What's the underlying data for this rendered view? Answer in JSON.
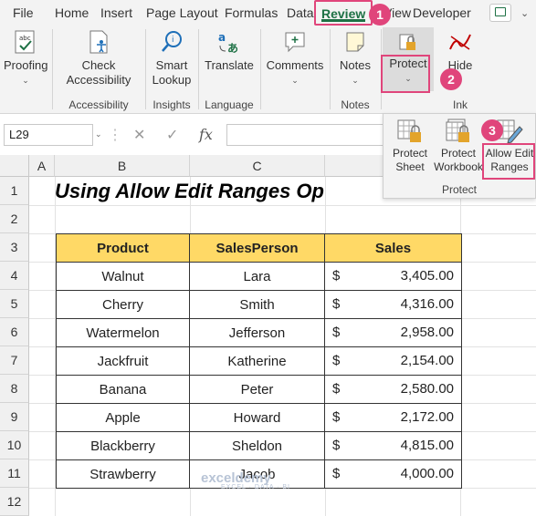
{
  "tabs": [
    "File",
    "Home",
    "Insert",
    "Page Layout",
    "Formulas",
    "Data",
    "Review",
    "View",
    "Developer"
  ],
  "active_tab": "Review",
  "ribbon": {
    "proofing": {
      "label": "Proofing"
    },
    "accessibility": {
      "button": "Check Accessibility",
      "group": "Accessibility"
    },
    "insights": {
      "button": "Smart Lookup",
      "group": "Insights"
    },
    "language": {
      "button": "Translate",
      "group": "Language"
    },
    "comments": {
      "button": "Comments"
    },
    "notes": {
      "button": "Notes",
      "group": "Notes"
    },
    "protect": {
      "button": "Protect"
    },
    "ink": {
      "button": "Hide",
      "group": "Ink"
    }
  },
  "protect_panel": {
    "protect_sheet": "Protect Sheet",
    "protect_workbook": "Protect Workbook",
    "allow_edit_ranges": "Allow Edit Ranges",
    "group": "Protect"
  },
  "badges": [
    "1",
    "2",
    "3"
  ],
  "formula_bar": {
    "name_box": "L29",
    "fx": "fx",
    "cancel": "✕",
    "enter": "✓"
  },
  "columns": [
    "A",
    "B",
    "C"
  ],
  "rows": [
    "1",
    "2",
    "3",
    "4",
    "5",
    "6",
    "7",
    "8",
    "9",
    "10",
    "11",
    "12"
  ],
  "sheet_title": "Using Allow Edit Ranges Op",
  "table": {
    "headers": [
      "Product",
      "SalesPerson",
      "Sales"
    ],
    "rows": [
      {
        "product": "Walnut",
        "person": "Lara",
        "cur": "$",
        "amount": "3,405.00"
      },
      {
        "product": "Cherry",
        "person": "Smith",
        "cur": "$",
        "amount": "4,316.00"
      },
      {
        "product": "Watermelon",
        "person": "Jefferson",
        "cur": "$",
        "amount": "2,958.00"
      },
      {
        "product": "Jackfruit",
        "person": "Katherine",
        "cur": "$",
        "amount": "2,154.00"
      },
      {
        "product": "Banana",
        "person": "Peter",
        "cur": "$",
        "amount": "2,580.00"
      },
      {
        "product": "Apple",
        "person": "Howard",
        "cur": "$",
        "amount": "2,172.00"
      },
      {
        "product": "Blackberry",
        "person": "Sheldon",
        "cur": "$",
        "amount": "4,815.00"
      },
      {
        "product": "Strawberry",
        "person": "Jacob",
        "cur": "$",
        "amount": "4,000.00"
      }
    ]
  },
  "watermark": {
    "name": "exceldemy",
    "tagline": "EXCEL · DATA · BI"
  },
  "colors": {
    "accent": "#e0457b",
    "excel_green": "#1e7145",
    "header_fill": "#ffd966"
  }
}
